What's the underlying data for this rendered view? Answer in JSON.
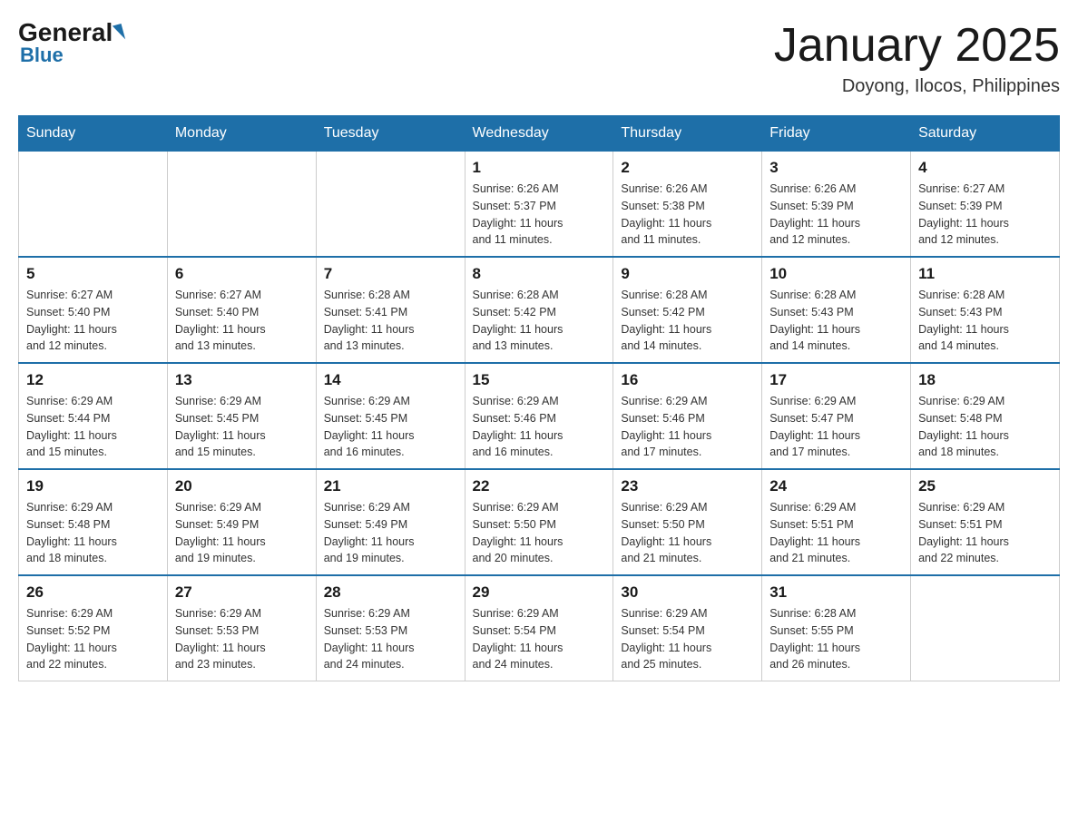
{
  "header": {
    "logo_general": "General",
    "logo_blue": "Blue",
    "month_title": "January 2025",
    "location": "Doyong, Ilocos, Philippines"
  },
  "days_of_week": [
    "Sunday",
    "Monday",
    "Tuesday",
    "Wednesday",
    "Thursday",
    "Friday",
    "Saturday"
  ],
  "weeks": [
    [
      {
        "day": "",
        "info": ""
      },
      {
        "day": "",
        "info": ""
      },
      {
        "day": "",
        "info": ""
      },
      {
        "day": "1",
        "info": "Sunrise: 6:26 AM\nSunset: 5:37 PM\nDaylight: 11 hours\nand 11 minutes."
      },
      {
        "day": "2",
        "info": "Sunrise: 6:26 AM\nSunset: 5:38 PM\nDaylight: 11 hours\nand 11 minutes."
      },
      {
        "day": "3",
        "info": "Sunrise: 6:26 AM\nSunset: 5:39 PM\nDaylight: 11 hours\nand 12 minutes."
      },
      {
        "day": "4",
        "info": "Sunrise: 6:27 AM\nSunset: 5:39 PM\nDaylight: 11 hours\nand 12 minutes."
      }
    ],
    [
      {
        "day": "5",
        "info": "Sunrise: 6:27 AM\nSunset: 5:40 PM\nDaylight: 11 hours\nand 12 minutes."
      },
      {
        "day": "6",
        "info": "Sunrise: 6:27 AM\nSunset: 5:40 PM\nDaylight: 11 hours\nand 13 minutes."
      },
      {
        "day": "7",
        "info": "Sunrise: 6:28 AM\nSunset: 5:41 PM\nDaylight: 11 hours\nand 13 minutes."
      },
      {
        "day": "8",
        "info": "Sunrise: 6:28 AM\nSunset: 5:42 PM\nDaylight: 11 hours\nand 13 minutes."
      },
      {
        "day": "9",
        "info": "Sunrise: 6:28 AM\nSunset: 5:42 PM\nDaylight: 11 hours\nand 14 minutes."
      },
      {
        "day": "10",
        "info": "Sunrise: 6:28 AM\nSunset: 5:43 PM\nDaylight: 11 hours\nand 14 minutes."
      },
      {
        "day": "11",
        "info": "Sunrise: 6:28 AM\nSunset: 5:43 PM\nDaylight: 11 hours\nand 14 minutes."
      }
    ],
    [
      {
        "day": "12",
        "info": "Sunrise: 6:29 AM\nSunset: 5:44 PM\nDaylight: 11 hours\nand 15 minutes."
      },
      {
        "day": "13",
        "info": "Sunrise: 6:29 AM\nSunset: 5:45 PM\nDaylight: 11 hours\nand 15 minutes."
      },
      {
        "day": "14",
        "info": "Sunrise: 6:29 AM\nSunset: 5:45 PM\nDaylight: 11 hours\nand 16 minutes."
      },
      {
        "day": "15",
        "info": "Sunrise: 6:29 AM\nSunset: 5:46 PM\nDaylight: 11 hours\nand 16 minutes."
      },
      {
        "day": "16",
        "info": "Sunrise: 6:29 AM\nSunset: 5:46 PM\nDaylight: 11 hours\nand 17 minutes."
      },
      {
        "day": "17",
        "info": "Sunrise: 6:29 AM\nSunset: 5:47 PM\nDaylight: 11 hours\nand 17 minutes."
      },
      {
        "day": "18",
        "info": "Sunrise: 6:29 AM\nSunset: 5:48 PM\nDaylight: 11 hours\nand 18 minutes."
      }
    ],
    [
      {
        "day": "19",
        "info": "Sunrise: 6:29 AM\nSunset: 5:48 PM\nDaylight: 11 hours\nand 18 minutes."
      },
      {
        "day": "20",
        "info": "Sunrise: 6:29 AM\nSunset: 5:49 PM\nDaylight: 11 hours\nand 19 minutes."
      },
      {
        "day": "21",
        "info": "Sunrise: 6:29 AM\nSunset: 5:49 PM\nDaylight: 11 hours\nand 19 minutes."
      },
      {
        "day": "22",
        "info": "Sunrise: 6:29 AM\nSunset: 5:50 PM\nDaylight: 11 hours\nand 20 minutes."
      },
      {
        "day": "23",
        "info": "Sunrise: 6:29 AM\nSunset: 5:50 PM\nDaylight: 11 hours\nand 21 minutes."
      },
      {
        "day": "24",
        "info": "Sunrise: 6:29 AM\nSunset: 5:51 PM\nDaylight: 11 hours\nand 21 minutes."
      },
      {
        "day": "25",
        "info": "Sunrise: 6:29 AM\nSunset: 5:51 PM\nDaylight: 11 hours\nand 22 minutes."
      }
    ],
    [
      {
        "day": "26",
        "info": "Sunrise: 6:29 AM\nSunset: 5:52 PM\nDaylight: 11 hours\nand 22 minutes."
      },
      {
        "day": "27",
        "info": "Sunrise: 6:29 AM\nSunset: 5:53 PM\nDaylight: 11 hours\nand 23 minutes."
      },
      {
        "day": "28",
        "info": "Sunrise: 6:29 AM\nSunset: 5:53 PM\nDaylight: 11 hours\nand 24 minutes."
      },
      {
        "day": "29",
        "info": "Sunrise: 6:29 AM\nSunset: 5:54 PM\nDaylight: 11 hours\nand 24 minutes."
      },
      {
        "day": "30",
        "info": "Sunrise: 6:29 AM\nSunset: 5:54 PM\nDaylight: 11 hours\nand 25 minutes."
      },
      {
        "day": "31",
        "info": "Sunrise: 6:28 AM\nSunset: 5:55 PM\nDaylight: 11 hours\nand 26 minutes."
      },
      {
        "day": "",
        "info": ""
      }
    ]
  ]
}
